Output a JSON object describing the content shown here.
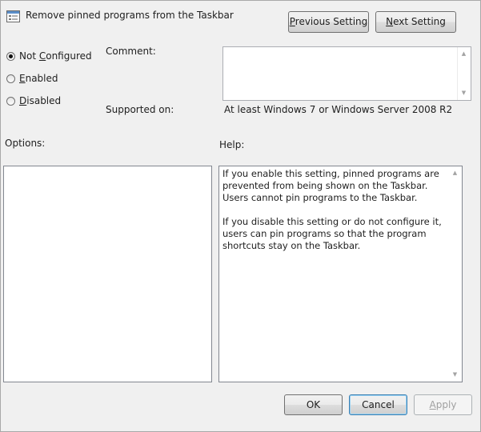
{
  "window": {
    "title": "Remove pinned programs from the Taskbar"
  },
  "nav": {
    "previous_label": "Previous Setting",
    "next_label": "Next Setting"
  },
  "state": {
    "not_configured": "Not Configured",
    "enabled": "Enabled",
    "disabled": "Disabled",
    "selected": "Not Configured"
  },
  "comment": {
    "label": "Comment:",
    "value": ""
  },
  "supported": {
    "label": "Supported on:",
    "value": "At least Windows 7 or Windows Server 2008 R2"
  },
  "options": {
    "label": "Options:"
  },
  "help": {
    "label": "Help:",
    "paragraph1": "If you enable this setting, pinned programs are prevented from being shown on the Taskbar. Users cannot pin programs to the Taskbar.",
    "paragraph2": "If you disable this setting or do not configure it, users can pin programs so that the program shortcuts stay on the Taskbar."
  },
  "footer": {
    "ok_label": "OK",
    "cancel_label": "Cancel",
    "apply_label": "Apply"
  },
  "icons": {
    "title": "policy-setting-icon",
    "scroll_up": "scroll-up-arrow-icon",
    "scroll_down": "scroll-down-arrow-icon"
  }
}
